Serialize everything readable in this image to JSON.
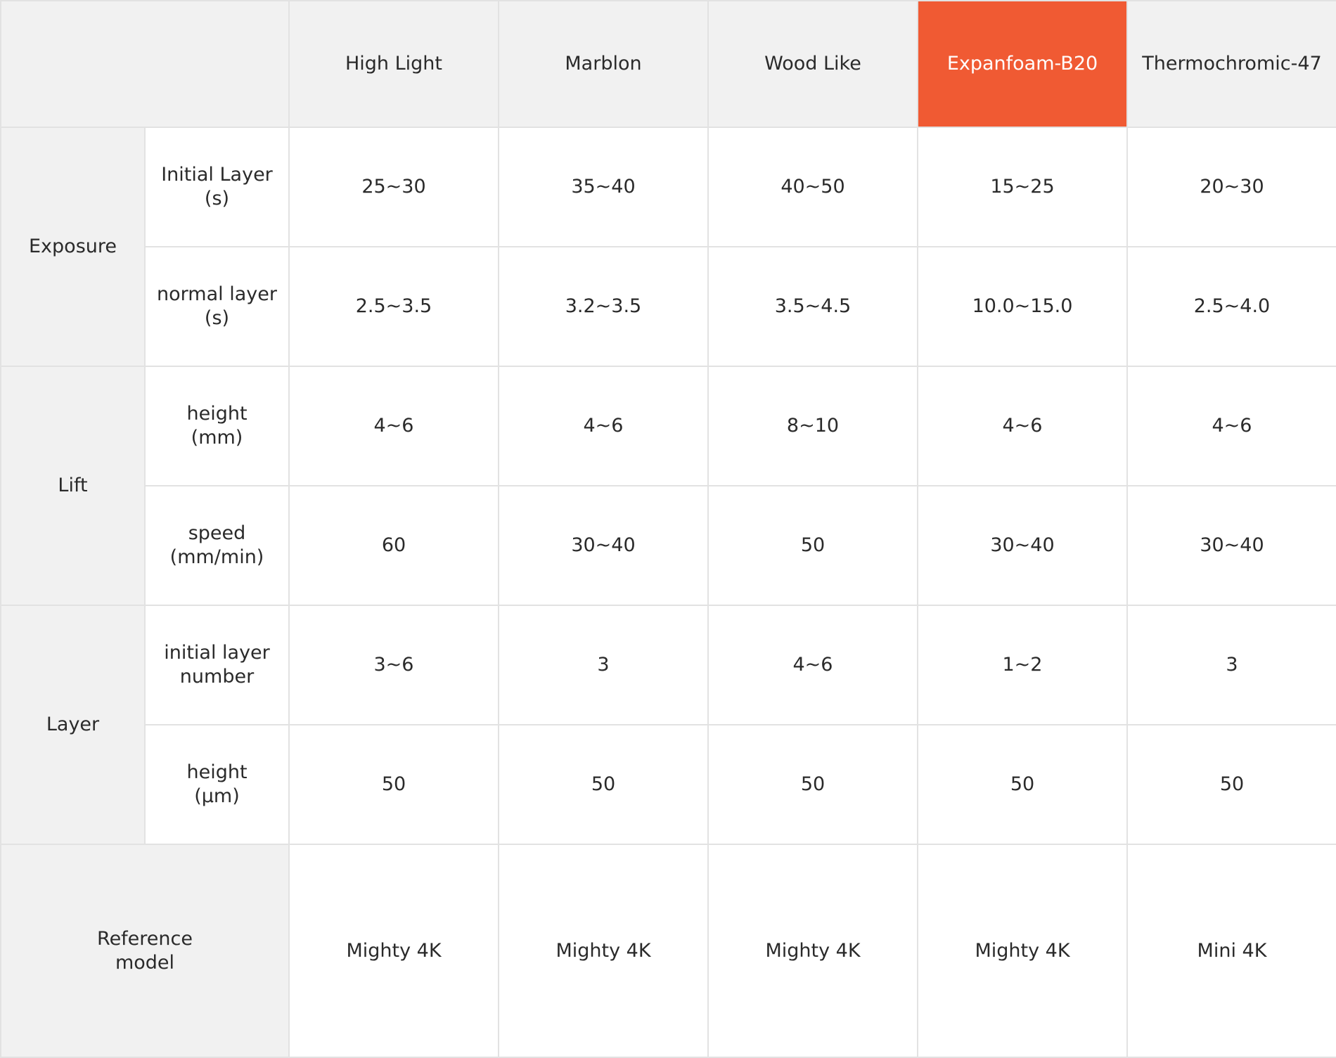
{
  "header": {
    "corner": "",
    "columns": [
      {
        "label": "High Light",
        "highlighted": false
      },
      {
        "label": "Marblon",
        "highlighted": false
      },
      {
        "label": "Wood Like",
        "highlighted": false
      },
      {
        "label": "Expanfoam-B20",
        "highlighted": true
      },
      {
        "label": "Thermochromic-47",
        "highlighted": false
      }
    ]
  },
  "groups": {
    "exposure": "Exposure",
    "lift": "Lift",
    "layer": "Layer"
  },
  "rows": [
    {
      "param": "Initial Layer\n(s)",
      "values": [
        "25~30",
        "35~40",
        "40~50",
        "15~25",
        "20~30"
      ]
    },
    {
      "param": "normal layer\n(s)",
      "values": [
        "2.5~3.5",
        "3.2~3.5",
        "3.5~4.5",
        "10.0~15.0",
        "2.5~4.0"
      ]
    },
    {
      "param": "height\n(mm)",
      "values": [
        "4~6",
        "4~6",
        "8~10",
        "4~6",
        "4~6"
      ]
    },
    {
      "param": "speed\n(mm/min)",
      "values": [
        "60",
        "30~40",
        "50",
        "30~40",
        "30~40"
      ]
    },
    {
      "param": "initial layer\nnumber",
      "values": [
        "3~6",
        "3",
        "4~6",
        "1~2",
        "3"
      ]
    },
    {
      "param": "height\n(μm)",
      "values": [
        "50",
        "50",
        "50",
        "50",
        "50"
      ]
    }
  ],
  "reference": {
    "label": "Reference\n model",
    "values": [
      "Mighty 4K",
      "Mighty 4K",
      "Mighty 4K",
      "Mighty 4K",
      "Mini 4K"
    ]
  },
  "colors": {
    "highlight": "#f05a33",
    "header_bg": "#f1f1f1",
    "border": "#e2e2e2"
  }
}
